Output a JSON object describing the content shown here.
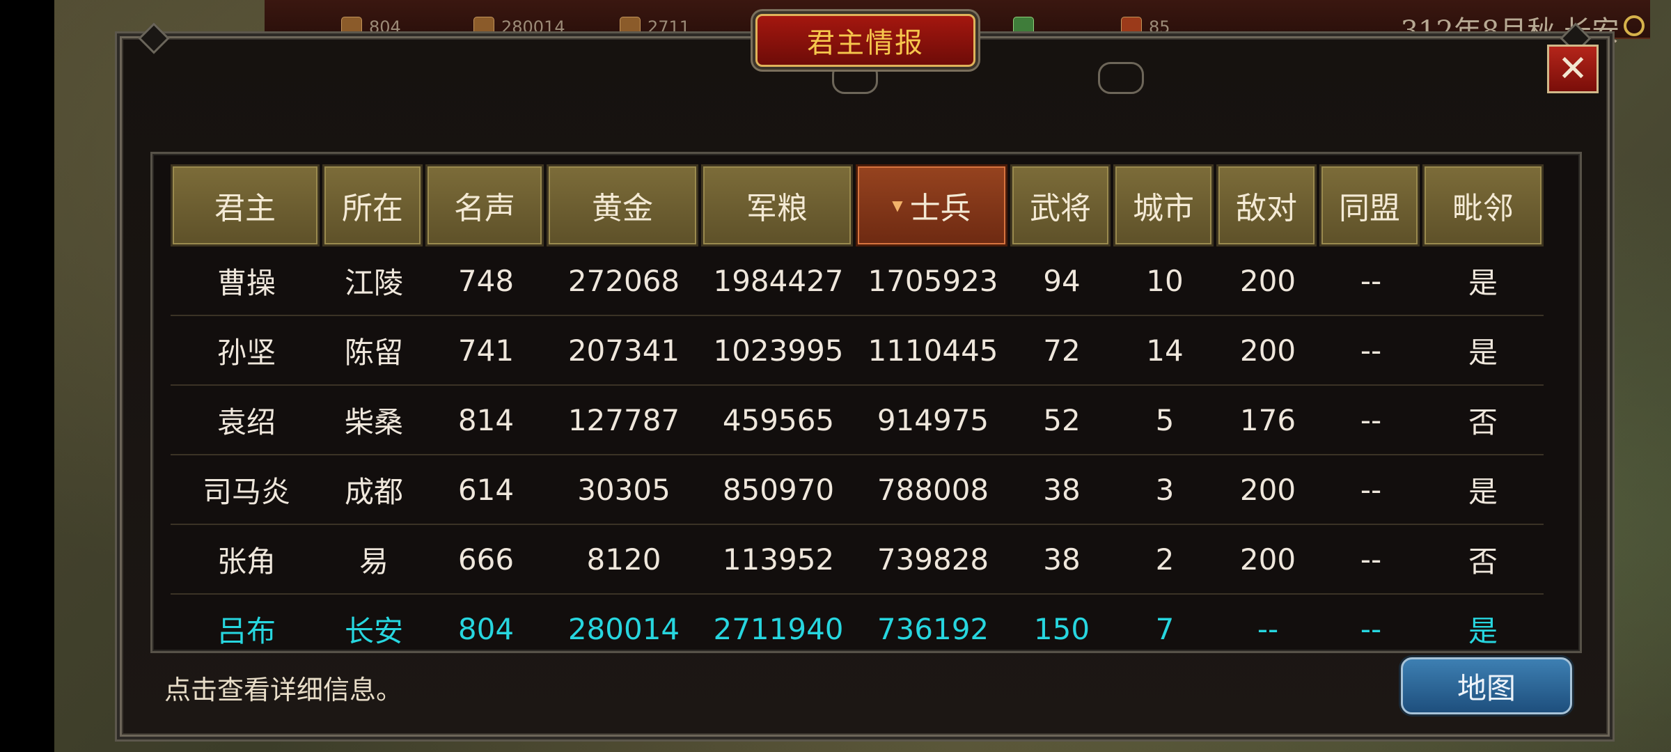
{
  "top_bar": {
    "resources": [
      {
        "icon": "fame-icon",
        "value": "804"
      },
      {
        "icon": "gold-icon",
        "value": "280014"
      },
      {
        "icon": "food-icon",
        "value": "2711"
      },
      {
        "icon": "soldier-icon",
        "value": ""
      },
      {
        "icon": "banner-icon",
        "value": "85"
      }
    ],
    "date": "312年8月秋 长安"
  },
  "dialog": {
    "title": "君主情报",
    "close_label": "✕",
    "hint": "点击查看详细信息。",
    "map_button": "地图"
  },
  "table": {
    "columns": [
      "君主",
      "所在",
      "名声",
      "黄金",
      "军粮",
      "士兵",
      "武将",
      "城市",
      "敌对",
      "同盟",
      "毗邻"
    ],
    "sorted_column": "士兵",
    "rows": [
      [
        "曹操",
        "江陵",
        "748",
        "272068",
        "1984427",
        "1705923",
        "94",
        "10",
        "200",
        "--",
        "是"
      ],
      [
        "孙坚",
        "陈留",
        "741",
        "207341",
        "1023995",
        "1110445",
        "72",
        "14",
        "200",
        "--",
        "是"
      ],
      [
        "袁绍",
        "柴桑",
        "814",
        "127787",
        "459565",
        "914975",
        "52",
        "5",
        "176",
        "--",
        "否"
      ],
      [
        "司马炎",
        "成都",
        "614",
        "30305",
        "850970",
        "788008",
        "38",
        "3",
        "200",
        "--",
        "是"
      ],
      [
        "张角",
        "易",
        "666",
        "8120",
        "113952",
        "739828",
        "38",
        "2",
        "200",
        "--",
        "否"
      ],
      [
        "吕布",
        "长安",
        "804",
        "280014",
        "2711940",
        "736192",
        "150",
        "7",
        "--",
        "--",
        "是"
      ]
    ],
    "player_row_index": 5,
    "player_color": "#27d6df"
  }
}
